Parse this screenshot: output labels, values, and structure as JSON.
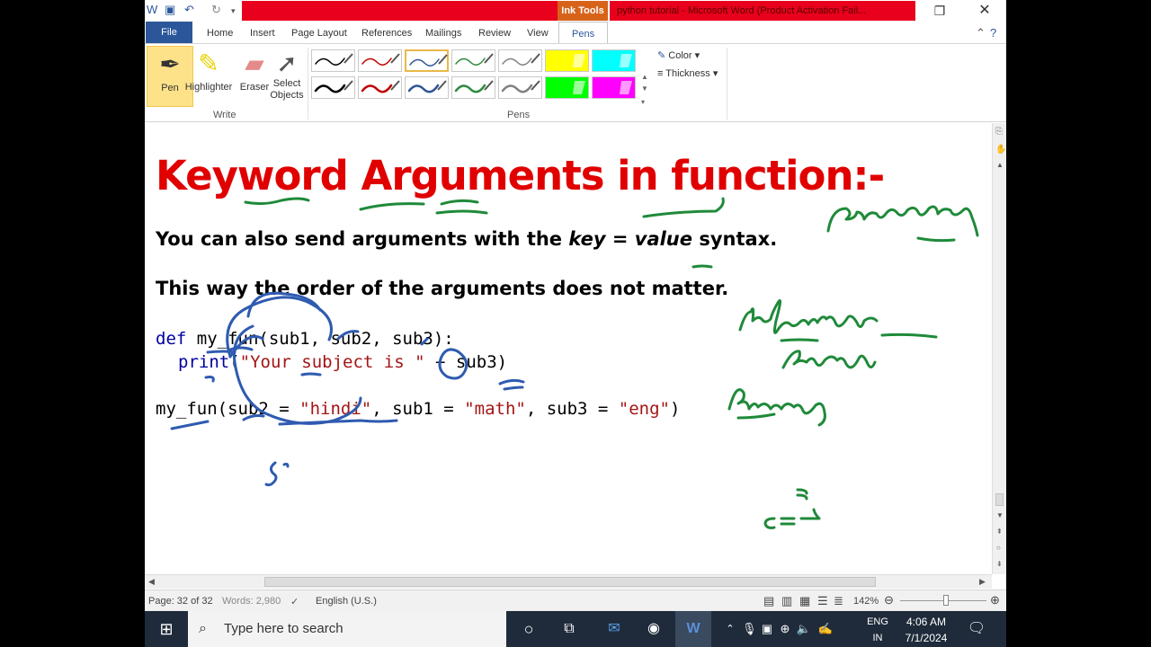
{
  "titlebar": {
    "contextual_tab": "Ink Tools",
    "document_title": "python tutorial - Microsoft Word (Product Activation Fail..."
  },
  "tabs": {
    "file": "File",
    "items": [
      "Home",
      "Insert",
      "Page Layout",
      "References",
      "Mailings",
      "Review",
      "View"
    ],
    "active": "Pens"
  },
  "ribbon": {
    "write_tools": [
      {
        "label": "Pen"
      },
      {
        "label": "Highlighter"
      },
      {
        "label": "Eraser"
      },
      {
        "label": "Select",
        "label2": "Objects"
      }
    ],
    "write_group": "Write",
    "pens_group": "Pens",
    "color_label": "Color",
    "thickness_label": "Thickness",
    "pen_colors_row1": [
      "#000000",
      "#c00000",
      "#2f5597",
      "#2e8b3d",
      "#808080",
      "#ffff00",
      "#00ffff"
    ],
    "pen_colors_row2": [
      "#000000",
      "#c00000",
      "#2f5597",
      "#2e8b3d",
      "#808080",
      "#00ff00",
      "#ff00ff"
    ]
  },
  "document": {
    "heading": "Keyword Arguments in function:-",
    "para1_a": "You can also send arguments with the ",
    "para1_key": "key",
    "para1_eq": " = ",
    "para1_value": "value",
    "para1_b": " syntax.",
    "para2": "This way the order of the arguments does not matter.",
    "code_def_kw": "def",
    "code_def_rest": " my_fun(sub1, sub2, sub3):",
    "code_print_kw": "print",
    "code_print_open": "(",
    "code_print_str": "\"Your subject is \"",
    "code_print_rest": " + sub3)",
    "code_call_a": "my_fun(sub2 = ",
    "code_call_s1": "\"hindi\"",
    "code_call_b": ", sub1 = ",
    "code_call_s2": "\"math\"",
    "code_call_c": ", sub3 = ",
    "code_call_s3": "\"eng\"",
    "code_call_d": ")"
  },
  "statusbar": {
    "page": "Page: 32 of 32",
    "words": "Words: 2,980",
    "language": "English (U.S.)",
    "zoom": "142%"
  },
  "taskbar": {
    "search_placeholder": "Type here to search",
    "lang1": "ENG",
    "lang2": "IN",
    "time": "4:06 AM",
    "date": "7/1/2024"
  }
}
